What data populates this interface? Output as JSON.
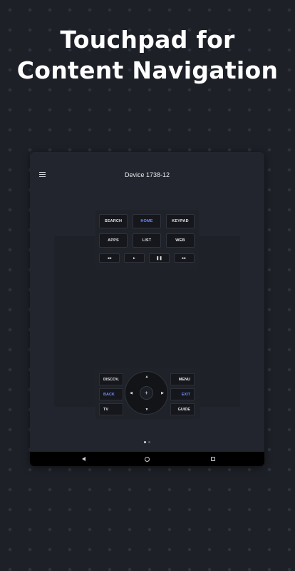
{
  "promo": {
    "line1": "Touchpad for",
    "line2": "Content Navigation"
  },
  "app_bar": {
    "title": "Device 1738-12",
    "menu_icon": "hamburger-menu-icon"
  },
  "remote": {
    "row1": [
      "SEARCH",
      "HOME",
      "KEYPAD"
    ],
    "row2": [
      "APPS",
      "LIST",
      "WEB"
    ],
    "media": [
      "◂◂",
      "▸",
      "❚❚",
      "▸▸"
    ],
    "active_button": "HOME"
  },
  "dpad": {
    "left": [
      "DISCOV.",
      "BACK",
      "TV"
    ],
    "right": [
      "MENU",
      "EXIT",
      "GUIDE"
    ],
    "center_icon": "crosshair-icon",
    "up": "▲",
    "down": "▼",
    "left_arrow": "◀",
    "right_arrow": "▶",
    "center": "+"
  },
  "pager": {
    "pages": 2,
    "current": 1
  },
  "colors": {
    "accent": "#6f8bff",
    "background": "#1d2027",
    "surface": "#22252d"
  },
  "system_nav": {
    "icons": [
      "back-triangle-icon",
      "home-circle-icon",
      "recents-square-icon"
    ]
  }
}
